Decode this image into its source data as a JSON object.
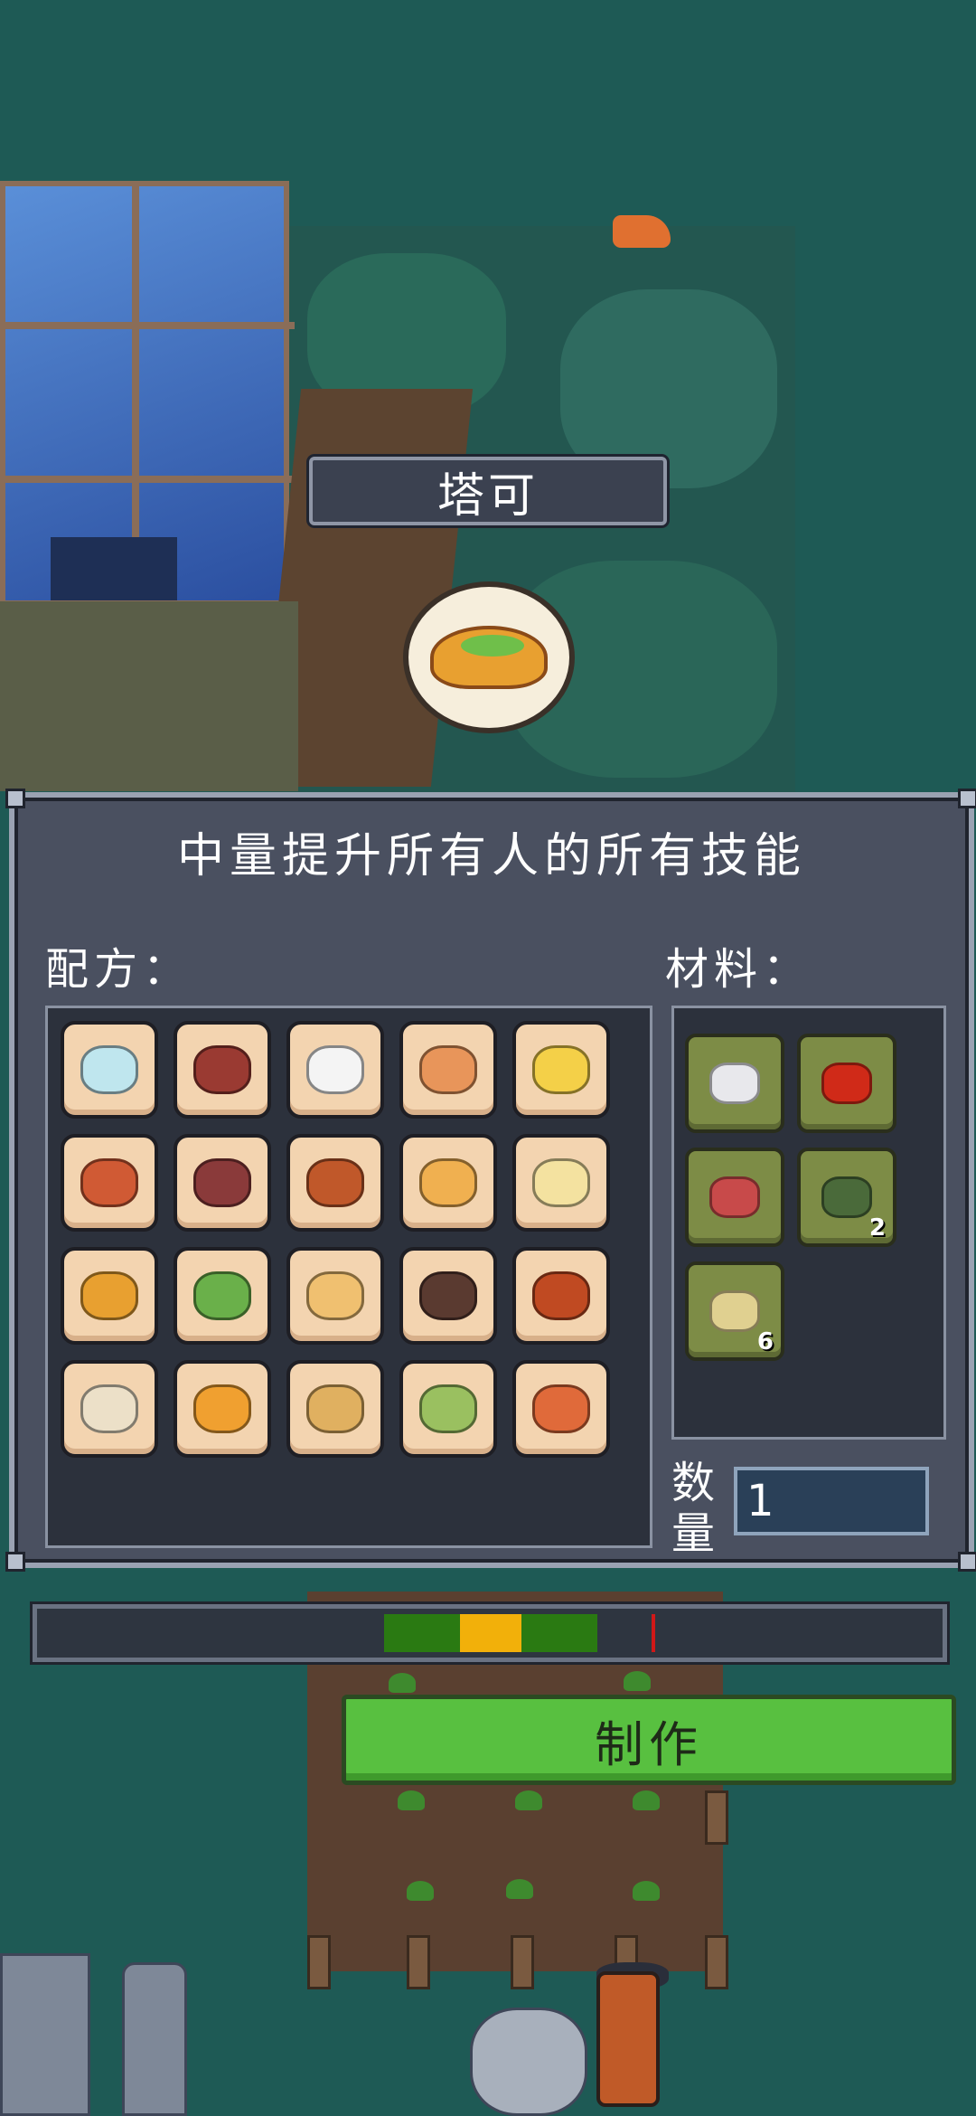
{
  "dish": {
    "name": "塔可",
    "icon": "taco-icon"
  },
  "panel": {
    "effect_text": "中量提升所有人的所有技能",
    "recipes_label": "配方：",
    "materials_label": "材料：",
    "quantity_label": "数量",
    "quantity_value": "1"
  },
  "recipes": [
    {
      "icon": "water-glass-icon",
      "color": "#bfe6ee"
    },
    {
      "icon": "steak-icon",
      "color": "#9a3a32"
    },
    {
      "icon": "egg-icon",
      "color": "#f4f4f4"
    },
    {
      "icon": "bread-rolls-icon",
      "color": "#e8955a"
    },
    {
      "icon": "scrambled-eggs-icon",
      "color": "#f4d048"
    },
    {
      "icon": "bacon-icon",
      "color": "#d05a34"
    },
    {
      "icon": "meat-salad-plate-icon",
      "color": "#8a3a3a"
    },
    {
      "icon": "spaghetti-plate-icon",
      "color": "#c0582a"
    },
    {
      "icon": "cheese-sandwich-icon",
      "color": "#f0b050"
    },
    {
      "icon": "cheese-wheel-icon",
      "color": "#f4e2a0"
    },
    {
      "icon": "taco-plate-icon",
      "color": "#e8a030"
    },
    {
      "icon": "club-sandwich-icon",
      "color": "#6ab04a"
    },
    {
      "icon": "bread-plate-icon",
      "color": "#f0c070"
    },
    {
      "icon": "chocolate-cake-icon",
      "color": "#5a3a30"
    },
    {
      "icon": "meatballs-plate-icon",
      "color": "#c04a22"
    },
    {
      "icon": "dumplings-plate-icon",
      "color": "#ece0c8"
    },
    {
      "icon": "omelette-rice-plate-icon",
      "color": "#f0a030"
    },
    {
      "icon": "noodle-soup-bowl-icon",
      "color": "#e0b060"
    },
    {
      "icon": "salad-bowl-icon",
      "color": "#9ac060"
    },
    {
      "icon": "fried-rice-plate-icon",
      "color": "#e06a3a"
    }
  ],
  "materials": [
    {
      "icon": "flour-bag-icon",
      "color": "#e8e8ec",
      "count": ""
    },
    {
      "icon": "chili-pepper-icon",
      "color": "#d02a18",
      "count": ""
    },
    {
      "icon": "raw-meat-icon",
      "color": "#c84a4a",
      "count": ""
    },
    {
      "icon": "herb-leaf-icon",
      "color": "#4a6a3a",
      "count": "2"
    },
    {
      "icon": "seasoning-bottles-icon",
      "color": "#e0d090",
      "count": "6"
    }
  ],
  "timing_bar": {
    "zone_colors": [
      "#2a7a12",
      "#f2b00a",
      "#2a7a12"
    ],
    "marker_color": "#d01818"
  },
  "craft_button": {
    "label": "制作",
    "color": "#58c040"
  }
}
